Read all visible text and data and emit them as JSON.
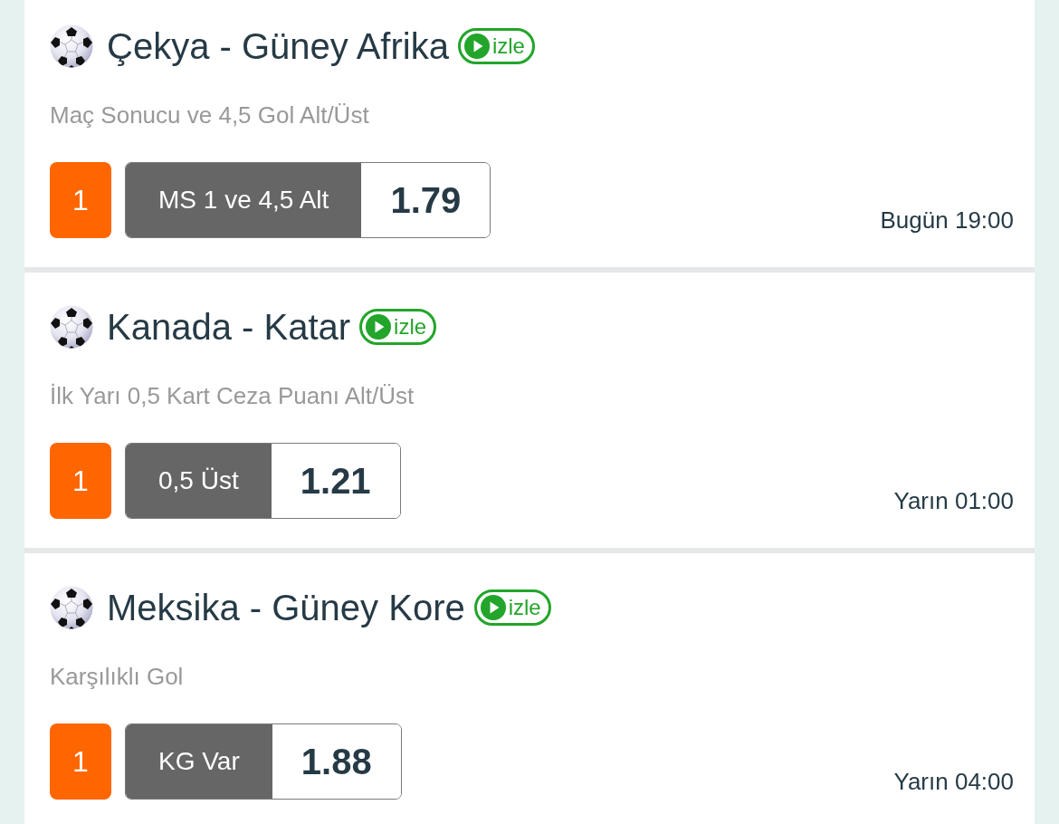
{
  "matches": [
    {
      "title": "Çekya - Güney Afrika",
      "watch_label": "izle",
      "market": "Maç Sonucu ve 4,5 Gol Alt/Üst",
      "pick_number": "1",
      "selection": "MS 1 ve 4,5 Alt",
      "odds": "1.79",
      "time": "Bugün 19:00"
    },
    {
      "title": "Kanada - Katar",
      "watch_label": "izle",
      "market": "İlk Yarı 0,5 Kart Ceza Puanı Alt/Üst",
      "pick_number": "1",
      "selection": "0,5 Üst",
      "odds": "1.21",
      "time": "Yarın 01:00"
    },
    {
      "title": "Meksika - Güney Kore",
      "watch_label": "izle",
      "market": "Karşılıklı Gol",
      "pick_number": "1",
      "selection": "KG Var",
      "odds": "1.88",
      "time": "Yarın 04:00"
    }
  ]
}
